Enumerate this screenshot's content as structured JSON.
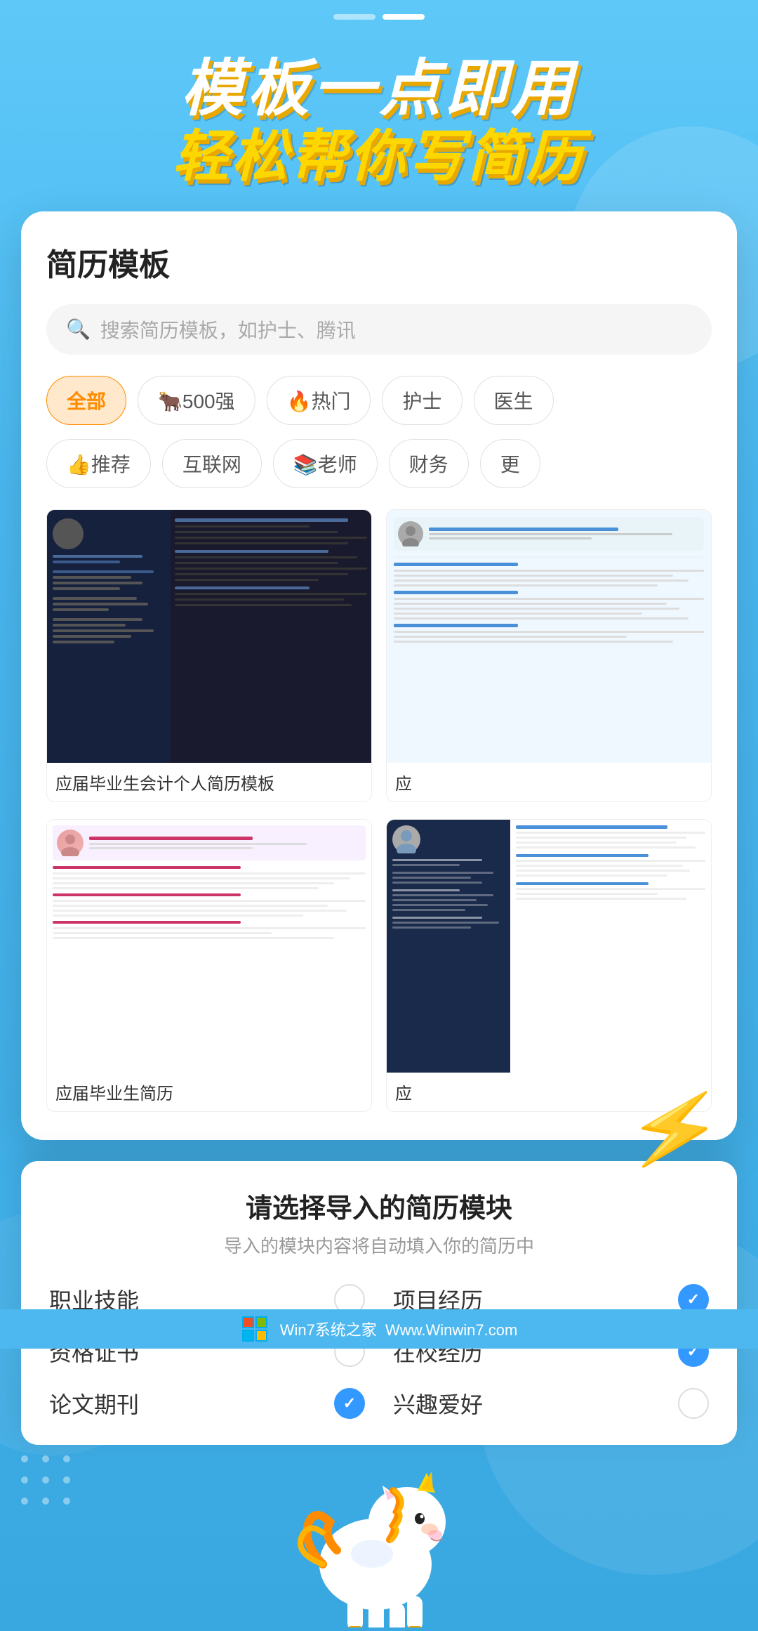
{
  "page": {
    "background_color": "#4db8f0"
  },
  "header": {
    "title_line1": "模板一点即用",
    "title_line2": "轻松帮你写简历"
  },
  "pagination": {
    "dots": [
      {
        "active": false
      },
      {
        "active": true
      }
    ]
  },
  "card": {
    "title": "简历模板",
    "search_placeholder": "搜索简历模板，如护士、腾讯"
  },
  "categories": {
    "row1": [
      {
        "label": "全部",
        "active": true
      },
      {
        "label": "🐂500强",
        "active": false
      },
      {
        "label": "🔥热门",
        "active": false
      },
      {
        "label": "护士",
        "active": false
      },
      {
        "label": "医生",
        "active": false
      }
    ],
    "row2": [
      {
        "label": "👍推荐",
        "active": false
      },
      {
        "label": "互联网",
        "active": false
      },
      {
        "label": "📚老师",
        "active": false
      },
      {
        "label": "财务",
        "active": false
      },
      {
        "label": "更多",
        "active": false
      }
    ]
  },
  "templates": [
    {
      "id": "t1",
      "name": "应届毕业生会计个人简历模板",
      "style": "dark"
    },
    {
      "id": "t2",
      "name": "应",
      "style": "light-blue"
    },
    {
      "id": "t3",
      "name": "应届毕业生简历",
      "style": "pink"
    },
    {
      "id": "t4",
      "name": "应",
      "style": "dark-sidebar"
    }
  ],
  "module_overlay": {
    "title": "请选择导入的简历模块",
    "subtitle": "导入的模块内容将自动填入你的简历中",
    "modules": [
      {
        "label": "职业技能",
        "checked": false
      },
      {
        "label": "项目经历",
        "checked": true
      },
      {
        "label": "资格证书",
        "checked": false
      },
      {
        "label": "在校经历",
        "checked": true
      },
      {
        "label": "论文期刊",
        "checked": true
      },
      {
        "label": "兴趣爱好",
        "checked": false
      }
    ]
  },
  "watermark": {
    "line1": "Win7系统之家",
    "line2": "Www.Winwin7.com"
  },
  "icons": {
    "search": "🔍",
    "lightning": "⚡",
    "check": "✓"
  }
}
